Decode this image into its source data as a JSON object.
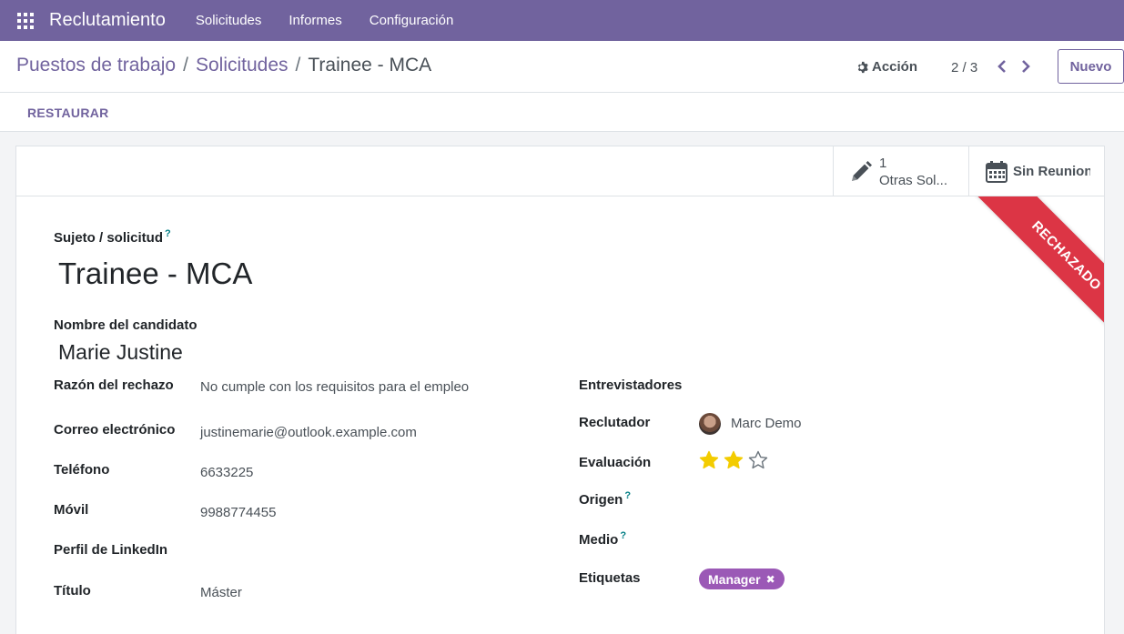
{
  "navbar": {
    "brand": "Reclutamiento",
    "menu": [
      "Solicitudes",
      "Informes",
      "Configuración"
    ]
  },
  "breadcrumb": {
    "items": [
      "Puestos de trabajo",
      "Solicitudes"
    ],
    "current": "Trainee - MCA",
    "separator": "/"
  },
  "control": {
    "action_label": "Acción",
    "pager": "2 / 3",
    "new_label": "Nuevo"
  },
  "statusbar": {
    "restore_label": "RESTAURAR"
  },
  "stat_buttons": {
    "other_apps": {
      "count": "1",
      "label": "Otras Sol..."
    },
    "meetings": {
      "label": "Sin Reuniones"
    }
  },
  "ribbon": {
    "text": "RECHAZADO",
    "color": "#dc3545"
  },
  "form": {
    "subject_label": "Sujeto / solicitud",
    "subject_value": "Trainee - MCA",
    "candidate_label": "Nombre del candidato",
    "candidate_value": "Marie Justine",
    "left": {
      "refuse_reason": {
        "label": "Razón del rechazo",
        "value": "No cumple con los requisitos para el empleo"
      },
      "email": {
        "label": "Correo electrónico",
        "value": "justinemarie@outlook.example.com"
      },
      "phone": {
        "label": "Teléfono",
        "value": "6633225"
      },
      "mobile": {
        "label": "Móvil",
        "value": "9988774455"
      },
      "linkedin": {
        "label": "Perfil de LinkedIn",
        "value": ""
      },
      "degree": {
        "label": "Título",
        "value": "Máster"
      }
    },
    "right": {
      "interviewers": {
        "label": "Entrevistadores"
      },
      "recruiter": {
        "label": "Reclutador",
        "value": "Marc Demo"
      },
      "evaluation": {
        "label": "Evaluación",
        "stars_filled": 2,
        "stars_total": 3
      },
      "source": {
        "label": "Origen"
      },
      "medium": {
        "label": "Medio"
      },
      "tags": {
        "label": "Etiquetas",
        "items": [
          "Manager"
        ],
        "tag_color": "#9b59b6"
      }
    },
    "help_mark": "?"
  },
  "colors": {
    "brand": "#71639e",
    "star": "#f3cc00"
  }
}
